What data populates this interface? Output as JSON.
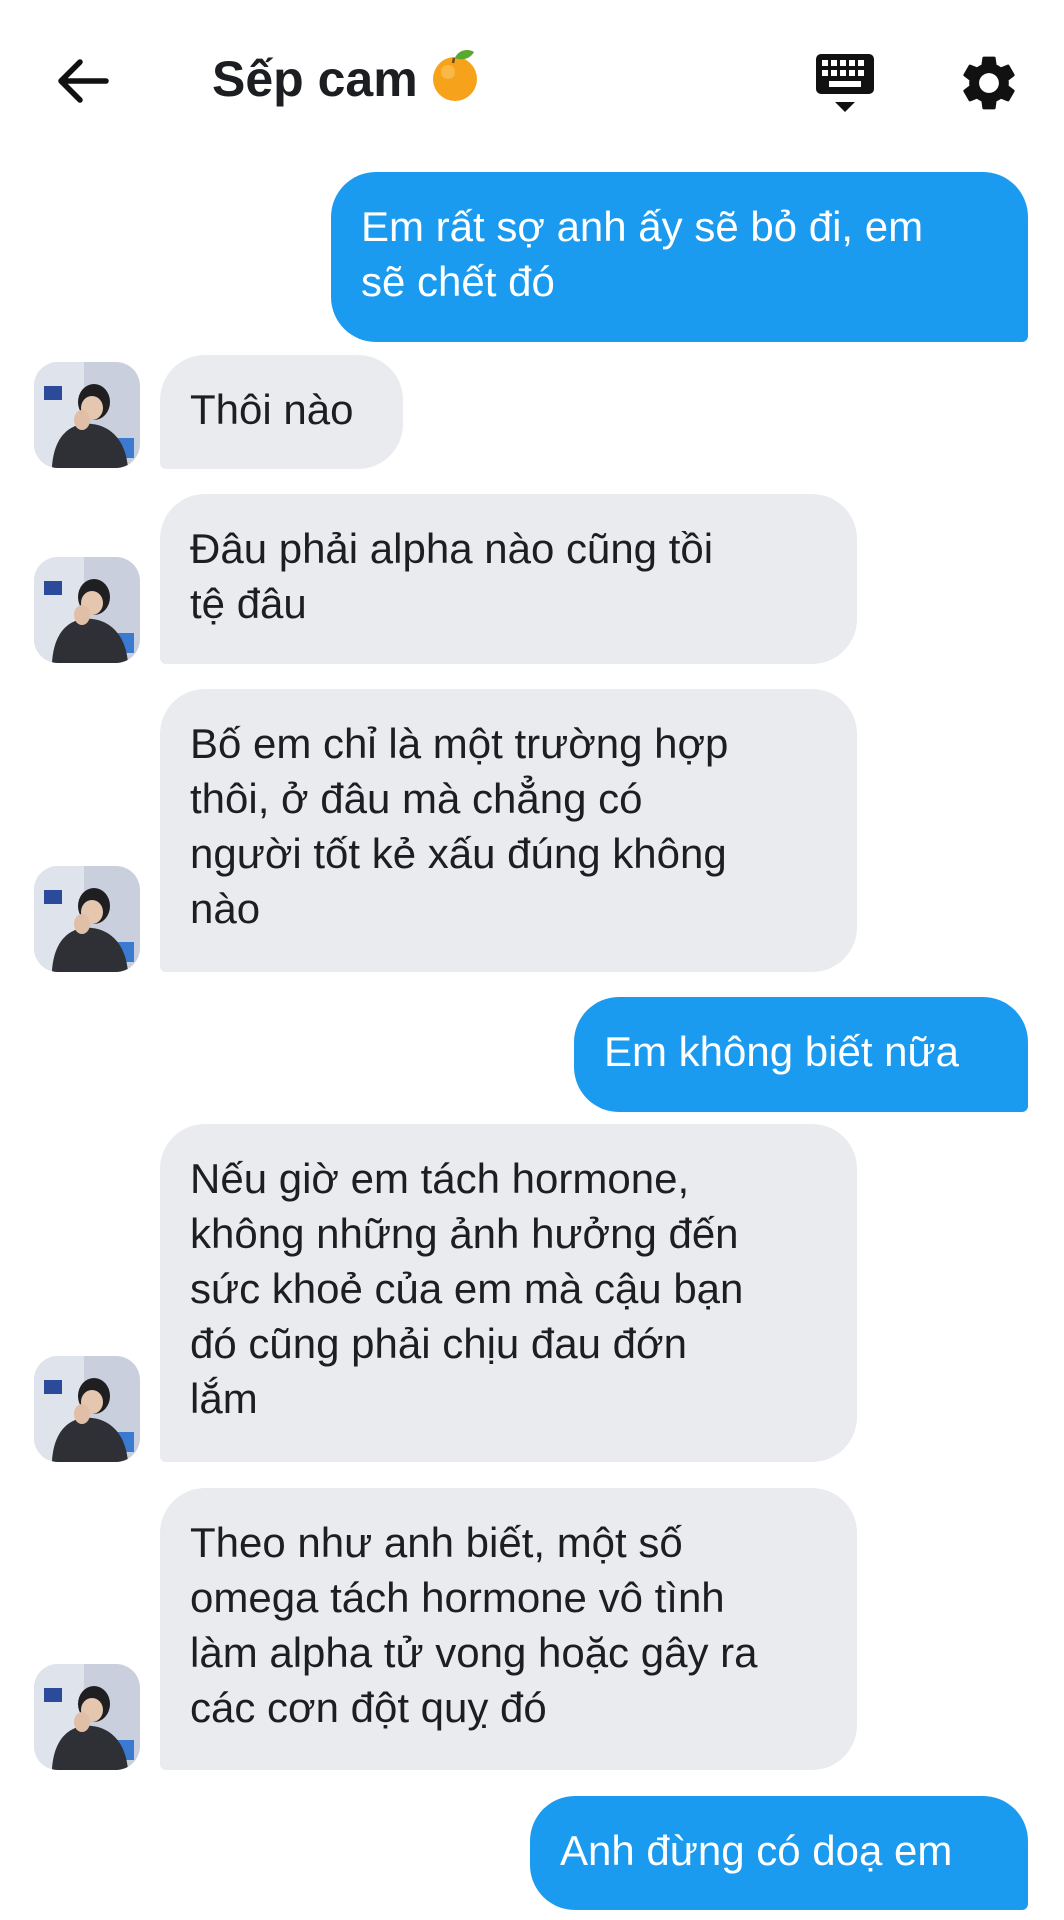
{
  "header": {
    "title": "Sếp cam",
    "back_icon": "arrow-left-icon",
    "title_emoji": "tangerine-emoji",
    "keyboard_icon": "keyboard-hide-icon",
    "settings_icon": "gear-icon"
  },
  "colors": {
    "outgoing_bubble": "#1b9bf0",
    "incoming_bubble": "#e9ebee",
    "text": "#1c1e21"
  },
  "messages": [
    {
      "direction": "out",
      "text": "Em rất sợ anh ấy sẽ bỏ đi, em\nsẽ chết đó"
    },
    {
      "direction": "in",
      "text": "Thôi nào"
    },
    {
      "direction": "in",
      "text": "Đâu phải alpha nào cũng tồi\ntệ đâu"
    },
    {
      "direction": "in",
      "text": "Bố em chỉ là một trường hợp\nthôi, ở đâu mà chẳng có\nngười tốt kẻ xấu đúng không\nnào"
    },
    {
      "direction": "out",
      "text": "Em không biết nữa"
    },
    {
      "direction": "in",
      "text": "Nếu giờ em tách hormone,\nkhông những ảnh hưởng đến\nsức khoẻ của em mà cậu bạn\nđó cũng phải chịu đau đớn\nlắm"
    },
    {
      "direction": "in",
      "text": "Theo như anh biết, một số\nomega tách hormone vô tình\nlàm alpha tử vong hoặc gây ra\ncác cơn đột quỵ đó"
    },
    {
      "direction": "out",
      "text": "Anh đừng có doạ em"
    }
  ]
}
